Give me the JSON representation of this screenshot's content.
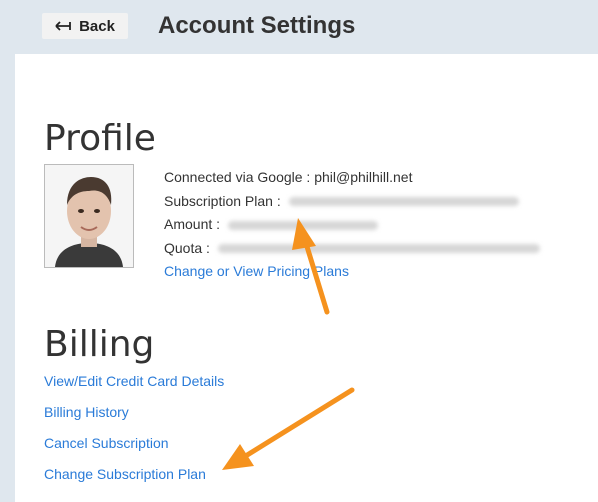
{
  "header": {
    "back_label": "Back",
    "title": "Account Settings"
  },
  "profile": {
    "heading": "Profile",
    "connected_label": "Connected via Google : ",
    "connected_email": "phil@philhill.net",
    "plan_label": "Subscription Plan :",
    "amount_label": "Amount :",
    "quota_label": "Quota :",
    "pricing_link": "Change or View Pricing Plans"
  },
  "billing": {
    "heading": "Billing",
    "links": [
      "View/Edit Credit Card Details",
      "Billing History",
      "Cancel Subscription",
      "Change Subscription Plan"
    ]
  },
  "colors": {
    "link": "#2a7bd8",
    "arrow": "#f5921e",
    "background": "#dfe7ee"
  }
}
